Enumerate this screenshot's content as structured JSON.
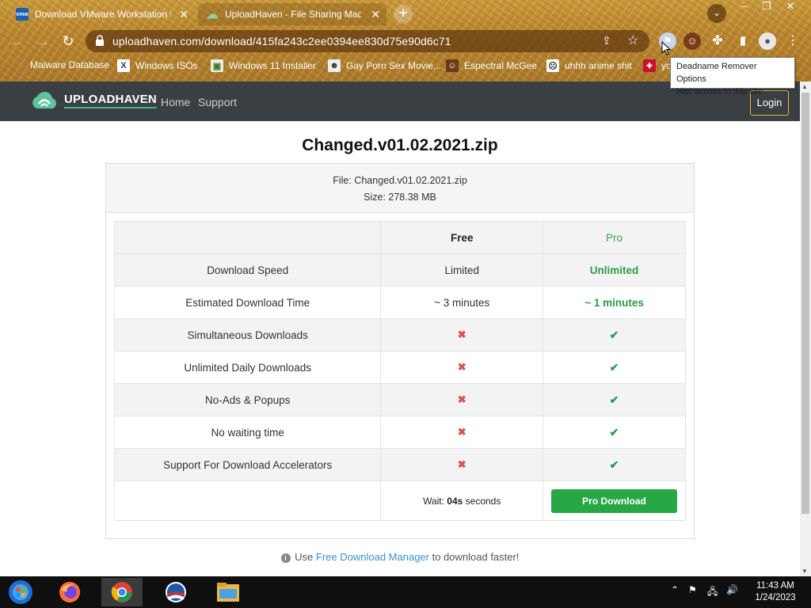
{
  "browser": {
    "tabs": [
      {
        "title": "Download VMware Workstation Pla",
        "favicon": "vmware-icon",
        "favicon_text": "vmw"
      },
      {
        "title": "UploadHaven - File Sharing Made",
        "favicon": "uploadhaven-cloud-icon",
        "favicon_text": ""
      }
    ],
    "new_tab": "+",
    "url": "uploadhaven.com/download/415fa243c2ee0394ee830d75e90d6c71",
    "bookmarks": [
      {
        "label": "Malware Database",
        "icon": "none"
      },
      {
        "label": "Windows ISOs",
        "icon": "x-icon"
      },
      {
        "label": "Windows 11 Installer",
        "icon": "image-icon"
      },
      {
        "label": "Gay Porn Sex Movie...",
        "icon": "avatar-icon"
      },
      {
        "label": "Espectral McGee",
        "icon": "avatar-icon"
      },
      {
        "label": "uhhh anime shit",
        "icon": "anime-icon"
      },
      {
        "label": "yo",
        "icon": "flag-icon"
      }
    ],
    "tooltip": {
      "line1": "Deadname Remover Options",
      "line2": "Has access to this site"
    }
  },
  "site": {
    "brand": "UPLOADHAVEN",
    "nav": {
      "home": "Home",
      "support": "Support",
      "login": "Login"
    },
    "file_title": "Changed.v01.02.2021.zip",
    "file_line": "File: Changed.v01.02.2021.zip",
    "size_line": "Size: 278.38 MB",
    "table": {
      "headers": [
        "",
        "Free",
        "Pro"
      ],
      "rows": [
        {
          "label": "Download Speed",
          "free": "Limited",
          "pro": "Unlimited"
        },
        {
          "label": "Estimated Download Time",
          "free": "~ 3 minutes",
          "pro": "~ 1 minutes"
        },
        {
          "label": "Simultaneous Downloads",
          "free": "✖",
          "pro": "✔"
        },
        {
          "label": "Unlimited Daily Downloads",
          "free": "✖",
          "pro": "✔"
        },
        {
          "label": "No-Ads & Popups",
          "free": "✖",
          "pro": "✔"
        },
        {
          "label": "No waiting time",
          "free": "✖",
          "pro": "✔"
        },
        {
          "label": "Support For Download Accelerators",
          "free": "✖",
          "pro": "✔"
        }
      ],
      "wait_prefix": "Wait: ",
      "wait_value": "04s",
      "wait_suffix": " seconds",
      "pro_download": "Pro Download"
    },
    "tip": {
      "prefix": "Use ",
      "link": "Free Download Manager",
      "suffix": " to download faster!"
    }
  },
  "taskbar": {
    "apps": [
      "windows-start-icon",
      "firefox-icon",
      "chrome-icon",
      "obama-icon",
      "file-explorer-icon"
    ],
    "time": "11:43 AM",
    "date": "1/24/2023"
  },
  "colors": {
    "navbar": "#3a3f44",
    "accent_green": "#28a745",
    "login_border": "#e8b43a",
    "cross_red": "#d9534f"
  }
}
